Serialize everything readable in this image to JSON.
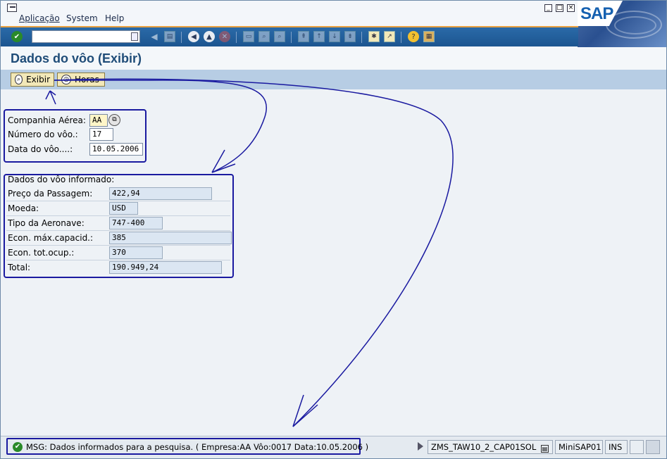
{
  "menu": {
    "items": [
      {
        "label": "Aplicação"
      },
      {
        "label": "System"
      },
      {
        "label": "Help"
      }
    ]
  },
  "logo": {
    "text": "SAP"
  },
  "toolbar": {
    "command_field_value": ""
  },
  "page": {
    "title": "Dados do vôo (Exibir)"
  },
  "app_toolbar": {
    "exibir_label": "Exibir",
    "horas_label": "Horas"
  },
  "selection": {
    "companhia_label": "Companhia Aérea:",
    "companhia_value": "AA",
    "numero_label": "Número do vôo.:",
    "numero_value": "17",
    "data_label": "Data do vôo....:",
    "data_value": "10.05.2006"
  },
  "details": {
    "heading": "Dados do vôo informado:",
    "rows": [
      {
        "label": "Preço da Passagem:",
        "value": "422,94"
      },
      {
        "label": "Moeda:",
        "value": "USD"
      },
      {
        "label": "Tipo da Aeronave:",
        "value": "747-400"
      },
      {
        "label": "Econ. máx.capacid.:",
        "value": "385"
      },
      {
        "label": "Econ. tot.ocup.:",
        "value": "370"
      },
      {
        "label": "Total:",
        "value": "190.949,24"
      }
    ]
  },
  "status": {
    "message": "MSG: Dados informados para a pesquisa. ( Empresa:AA  Vôo:0017  Data:10.05.2006 )",
    "program": "ZMS_TAW10_2_CAP01SOL",
    "system": "MiniSAP01",
    "mode": "INS"
  }
}
